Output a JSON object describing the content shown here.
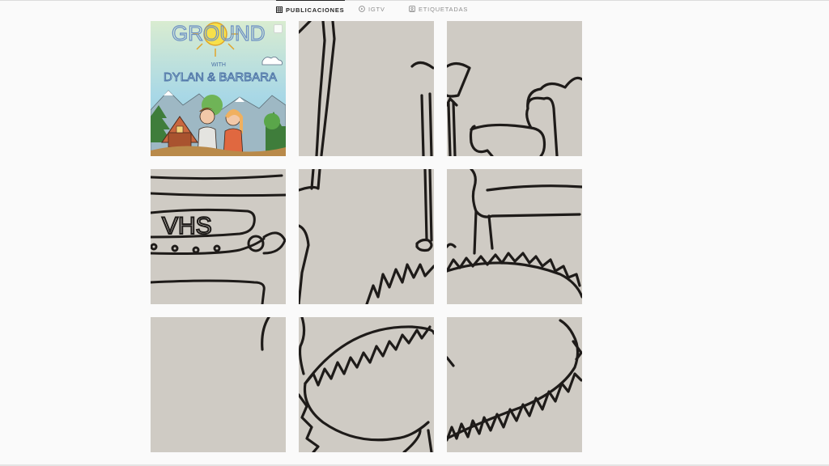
{
  "tabs": [
    {
      "label": "PUBLICACIONES",
      "icon": "grid-icon",
      "active": true
    },
    {
      "label": "IGTV",
      "icon": "igtv-icon",
      "active": false
    },
    {
      "label": "ETIQUETADAS",
      "icon": "tagged-icon",
      "active": false
    }
  ],
  "posts": {
    "cover": {
      "title_art": "GROUND",
      "with": "WITH",
      "names": "DYLAN & BARBARA"
    },
    "vhs_text": "VHS"
  },
  "colors": {
    "background": "#fafafa",
    "paper": "#cfcbc4",
    "ink": "#1e1b19",
    "active_tab": "#262626",
    "inactive_tab": "#8e8e8e"
  }
}
